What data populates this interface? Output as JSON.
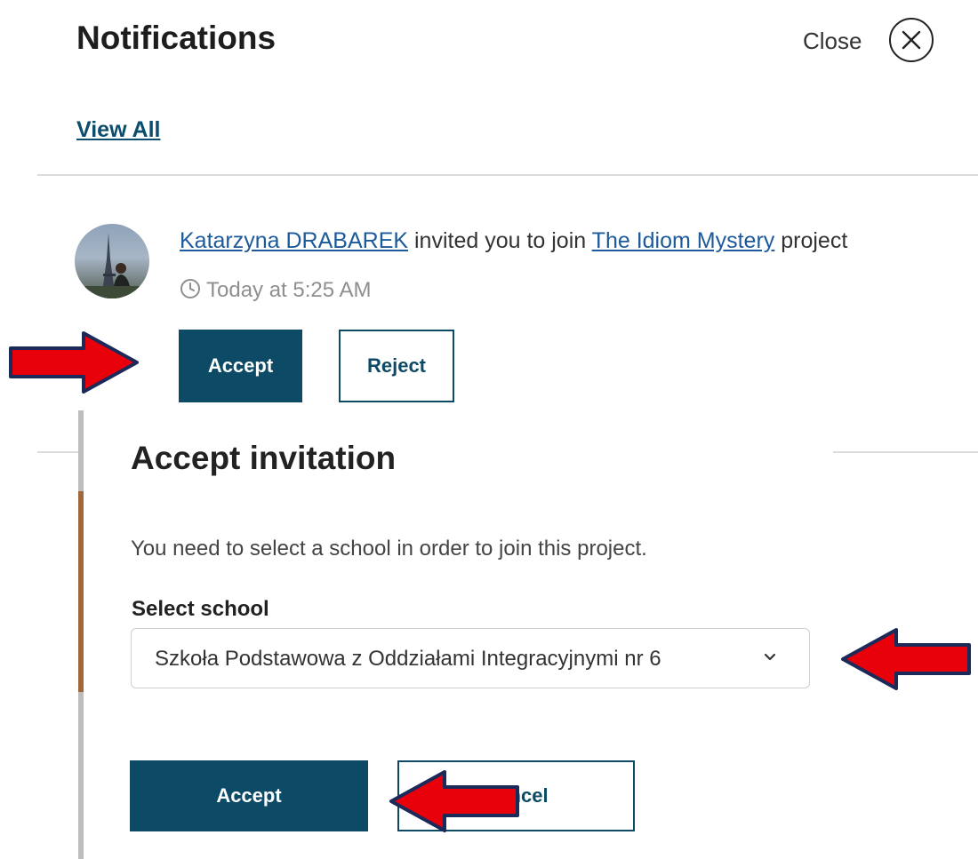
{
  "header": {
    "title": "Notifications",
    "close_label": "Close",
    "view_all": "View All"
  },
  "notification": {
    "sender": "Katarzyna DRABAREK",
    "text_mid": " invited you to join ",
    "project": "The Idiom Mystery",
    "text_end": " project",
    "time": "Today at 5:25 AM",
    "accept_label": "Accept",
    "reject_label": "Reject"
  },
  "modal": {
    "title": "Accept invitation",
    "description": "You need to select a school in order to join this project.",
    "select_label": "Select school",
    "selected_school": "Szkoła Podstawowa z Oddziałami Integracyjnymi nr 6",
    "accept_label": "Accept",
    "cancel_label": "Cancel"
  },
  "colors": {
    "primary": "#0c4a66",
    "link": "#1d5a9c",
    "annotation_arrow": "#e8000a",
    "annotation_outline": "#1c2a5a"
  },
  "icons": [
    "close-icon",
    "clock-icon",
    "chevron-down-icon",
    "annotation-arrow-icon"
  ]
}
